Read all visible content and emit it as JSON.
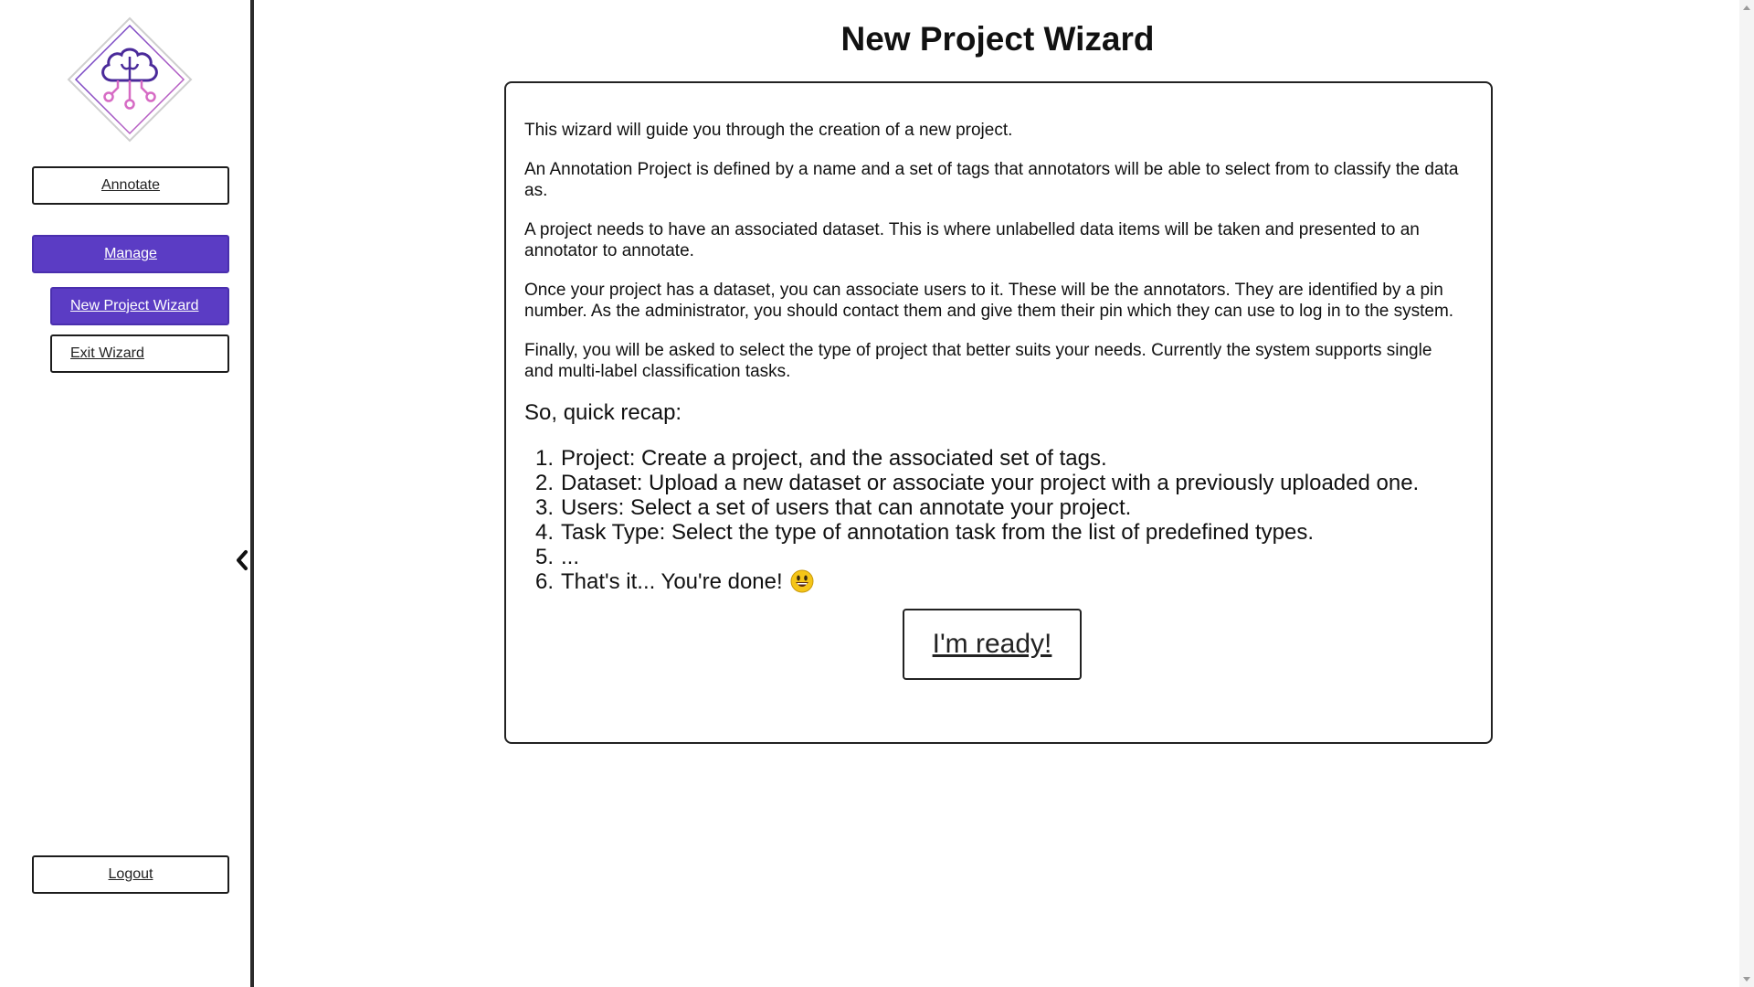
{
  "sidebar": {
    "logo_icon": "brain-circuit-logo",
    "nav": {
      "annotate": "Annotate",
      "manage": "Manage",
      "new_project_wizard": "New Project Wizard",
      "exit_wizard": "Exit Wizard",
      "logout": "Logout"
    },
    "collapse_icon": "chevron-left-icon"
  },
  "main": {
    "title": "New Project Wizard",
    "paragraphs": [
      "This wizard will guide you through the creation of a new project.",
      "An Annotation Project is defined by a name and a set of tags that annotators will be able to select from to classify the data as.",
      "A project needs to have an associated dataset. This is where unlabelled data items will be taken and presented to an annotator to annotate.",
      "Once your project has a dataset, you can associate users to it. These will be the annotators. They are identified by a pin number. As the administrator, you should contact them and give them their pin which they can use to log in to the system.",
      "Finally, you will be asked to select the type of project that better suits your needs. Currently the system supports single and multi-label classification tasks."
    ],
    "recap_title": "So, quick recap:",
    "recap_items": [
      {
        "num": "1.",
        "text": "Project: Create a project, and the associated set of tags."
      },
      {
        "num": "2.",
        "text": "Dataset: Upload a new dataset or associate your project with a previously uploaded one."
      },
      {
        "num": "3.",
        "text": "Users: Select a set of users that can annotate your project."
      },
      {
        "num": "4.",
        "text": "Task Type: Select the type of annotation task from the list of predefined types."
      },
      {
        "num": "5.",
        "text": "..."
      },
      {
        "num": "6.",
        "text": "That's it... You're done!"
      }
    ],
    "done_emoji_icon": "smiley-emoji-icon",
    "ready_button": "I'm ready!"
  },
  "colors": {
    "accent": "#5b3cc4",
    "logo_purple": "#4a2a9a",
    "logo_pink": "#d66bc4"
  }
}
